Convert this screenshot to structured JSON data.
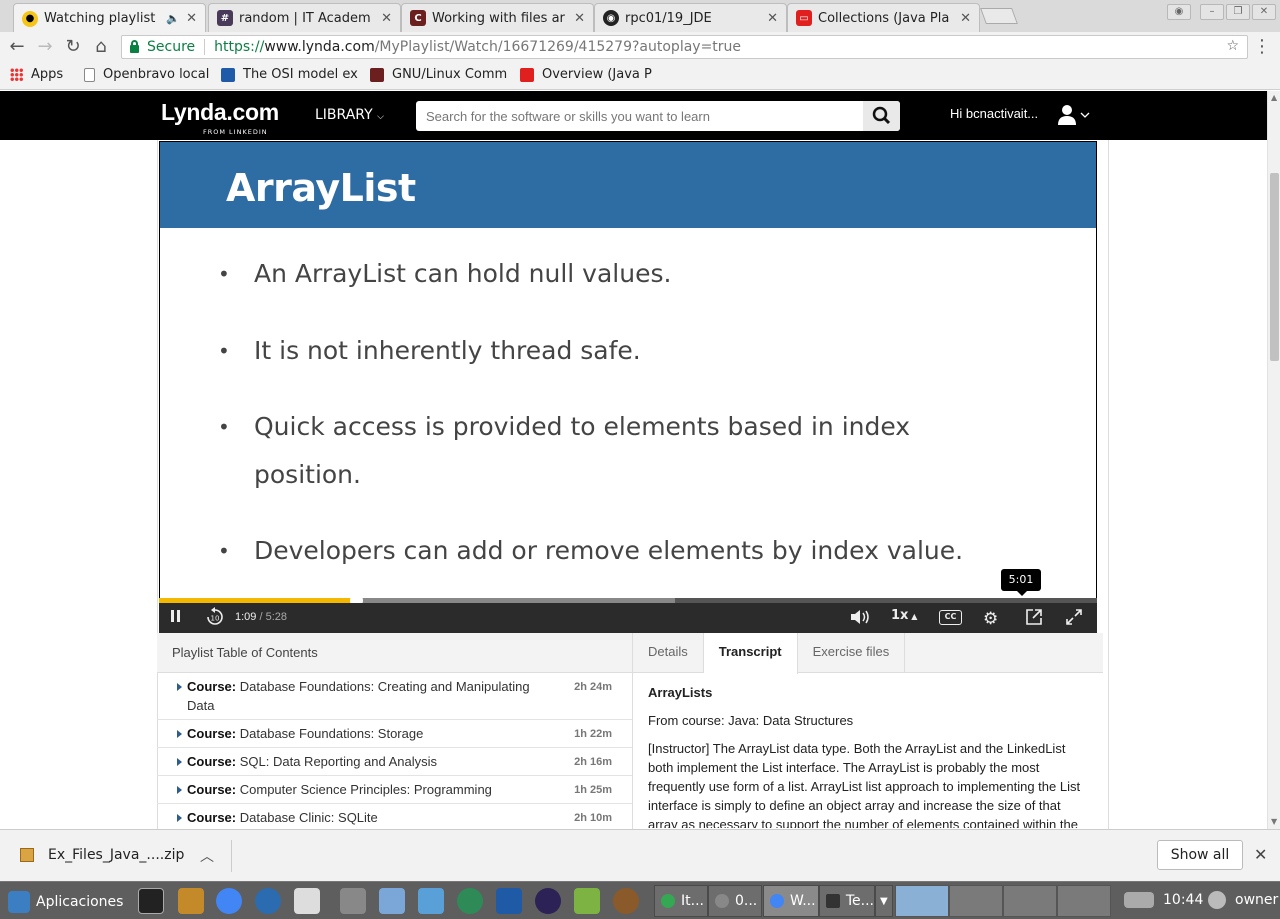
{
  "browser": {
    "tabs": [
      {
        "title": "Watching playlist",
        "icon": "lynda-favicon",
        "active": true
      },
      {
        "title": "random | IT Academ",
        "icon": "slack-favicon"
      },
      {
        "title": "Working with files ar",
        "icon": "book-favicon"
      },
      {
        "title": "rpc01/19_JDE",
        "icon": "github-favicon"
      },
      {
        "title": "Collections (Java Pla",
        "icon": "oracle-favicon"
      }
    ],
    "address": {
      "secure_label": "Secure",
      "scheme": "https://",
      "host": "www.lynda.com",
      "path": "/MyPlaylist/Watch/16671269/415279?autoplay=true"
    },
    "bookmarks": [
      {
        "label": "Apps",
        "icon": "apps-grid-icon"
      },
      {
        "label": "Openbravo local",
        "icon": "page-icon"
      },
      {
        "label": "The OSI model ex",
        "icon": "nw-icon"
      },
      {
        "label": "GNU/Linux Comm",
        "icon": "book-icon"
      },
      {
        "label": "Overview (Java P",
        "icon": "oracle-icon"
      }
    ]
  },
  "site": {
    "logo": "Lynda.com",
    "logo_sub": "FROM LINKEDIN",
    "library_label": "LIBRARY",
    "search_placeholder": "Search for the software or skills you want to learn",
    "greeting": "Hi bcnactivait..."
  },
  "video": {
    "slide_title": "ArrayList",
    "bullets": [
      "An ArrayList can hold null values.",
      "It is not inherently thread safe.",
      "Quick access is provided to elements based in index position.",
      "Developers can add or remove elements by index value."
    ],
    "current_time": "1:09",
    "duration": "5:28",
    "tooltip_time": "5:01",
    "speed": "1x",
    "cc_label": "CC",
    "progress_fraction": 0.21,
    "buffered_fraction": 0.55,
    "progress_color": "#f5b800"
  },
  "playlist": {
    "heading": "Playlist Table of Contents",
    "items": [
      {
        "prefix": "Course:",
        "title": "Database Foundations: Creating and Manipulating Data",
        "duration": "2h 24m"
      },
      {
        "prefix": "Course:",
        "title": "Database Foundations: Storage",
        "duration": "1h 22m"
      },
      {
        "prefix": "Course:",
        "title": "SQL: Data Reporting and Analysis",
        "duration": "2h 16m"
      },
      {
        "prefix": "Course:",
        "title": "Computer Science Principles: Programming",
        "duration": "1h 25m"
      },
      {
        "prefix": "Course:",
        "title": "Database Clinic: SQLite",
        "duration": "2h 10m"
      }
    ]
  },
  "panel": {
    "tabs": [
      "Details",
      "Transcript",
      "Exercise files"
    ],
    "active_tab": "Transcript",
    "heading": "ArrayLists",
    "from_course": "From course: Java: Data Structures",
    "transcript": "[Instructor] The ArrayList data type. Both the ArrayList and the LinkedList both implement the List interface. The ArrayList is probably the most frequently use form of a list. ArrayList list approach to implementing the List interface is simply to define an object array and increase the size of that array as necessary to support the number of elements contained within the"
  },
  "download": {
    "filename": "Ex_Files_Java_....zip",
    "show_all": "Show all"
  },
  "taskbar": {
    "menu_label": "Aplicaciones",
    "tasks": [
      {
        "label": "It...",
        "dot": "#34a853"
      },
      {
        "label": "0...",
        "dot": "#888888"
      },
      {
        "label": "W...",
        "dot": "#4285f4"
      },
      {
        "label": "Te...",
        "dot": "#333333"
      }
    ],
    "clock": "10:44",
    "user": "owner"
  },
  "colors": {
    "header_bg": "#000000",
    "slide_band": "#2e6da4",
    "toc_arrow": "#2e5d8a"
  }
}
